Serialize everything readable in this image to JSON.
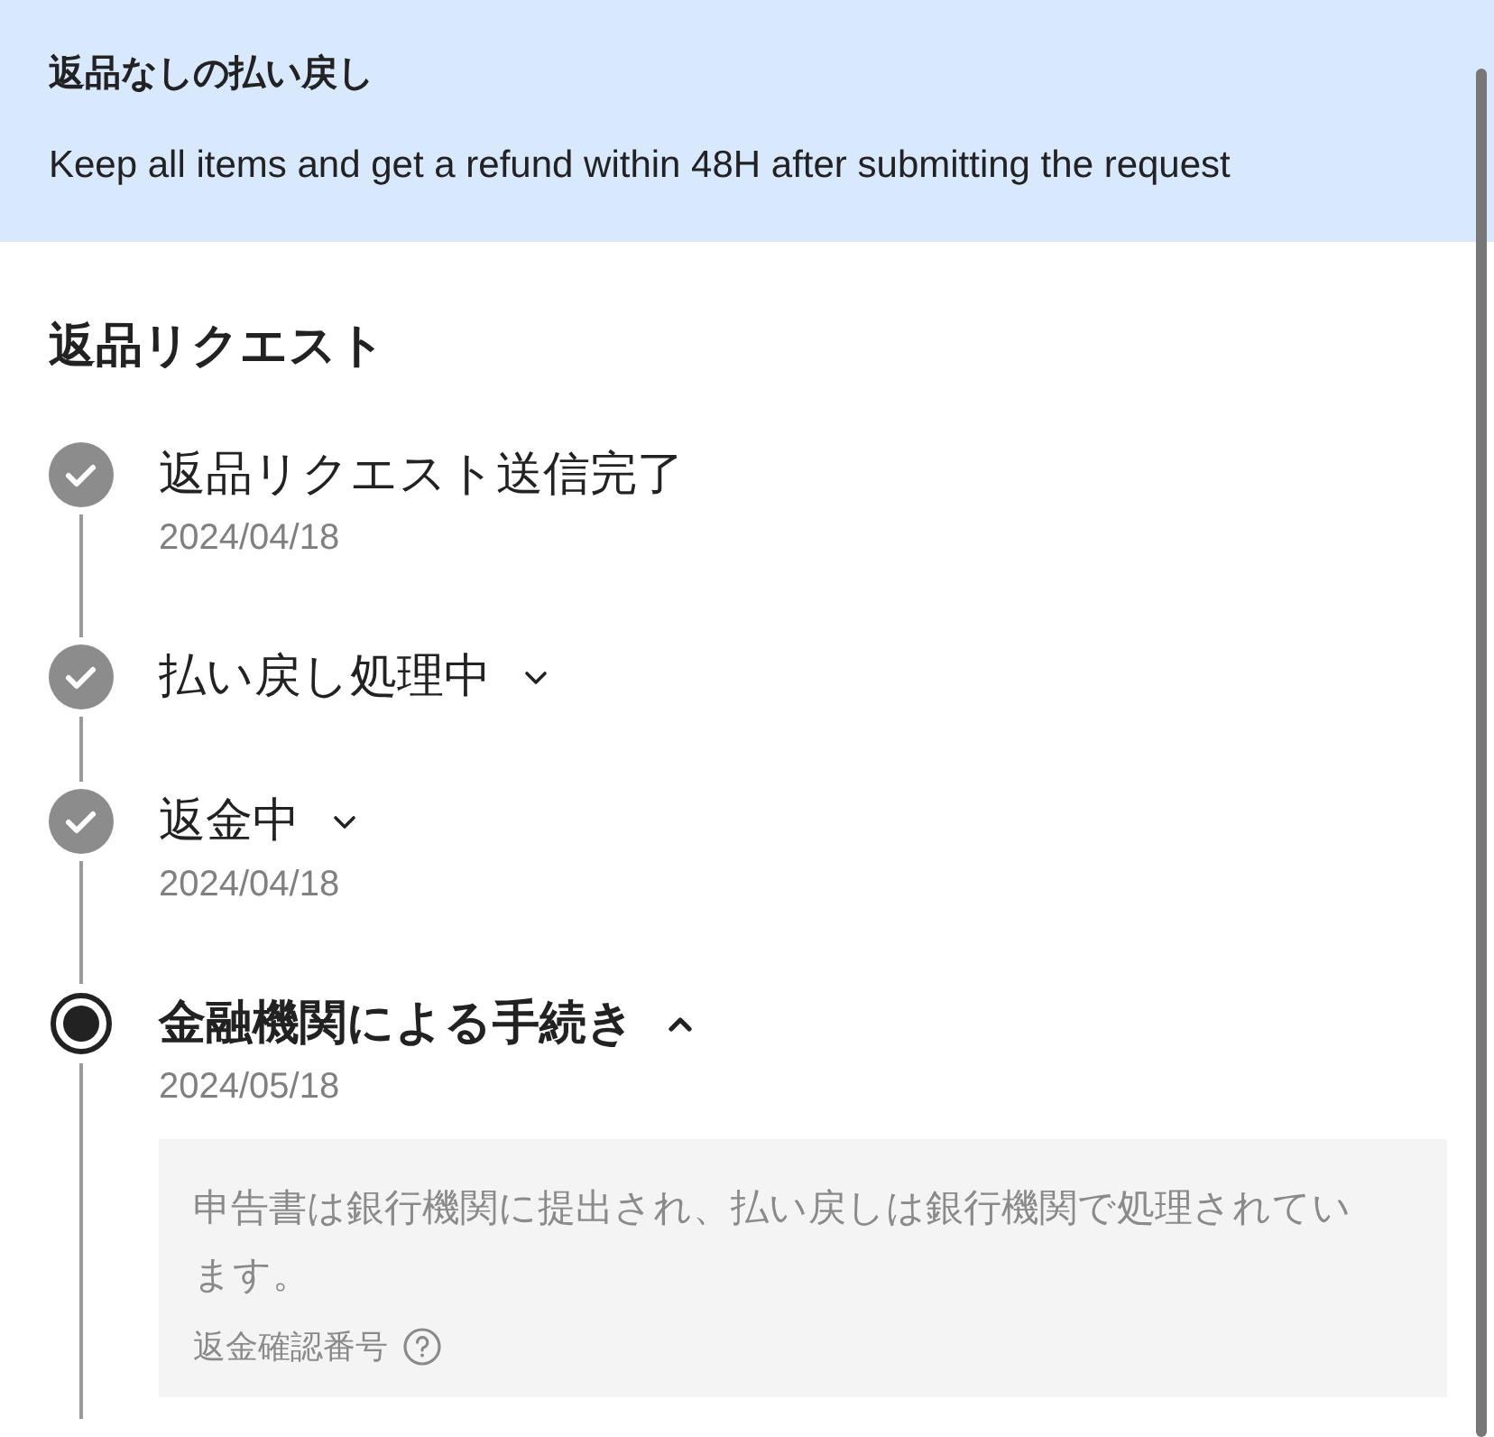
{
  "banner": {
    "title": "返品なしの払い戻し",
    "text": "Keep all items and get a refund within 48H after submitting the request"
  },
  "section_title": "返品リクエスト",
  "steps": [
    {
      "title": "返品リクエスト送信完了",
      "completed": true,
      "date": "2024/04/18"
    },
    {
      "title": "払い戻し処理中",
      "completed": true,
      "expanded": false
    },
    {
      "title": "返金中",
      "completed": true,
      "expanded": false,
      "date": "2024/04/18"
    },
    {
      "title": "金融機関による手続き",
      "completed": false,
      "expanded": true,
      "date": "2024/05/18",
      "detail": {
        "text": "申告書は銀行機関に提出され、払い戻しは銀行機関で処理されています。",
        "label": "返金確認番号"
      }
    }
  ]
}
